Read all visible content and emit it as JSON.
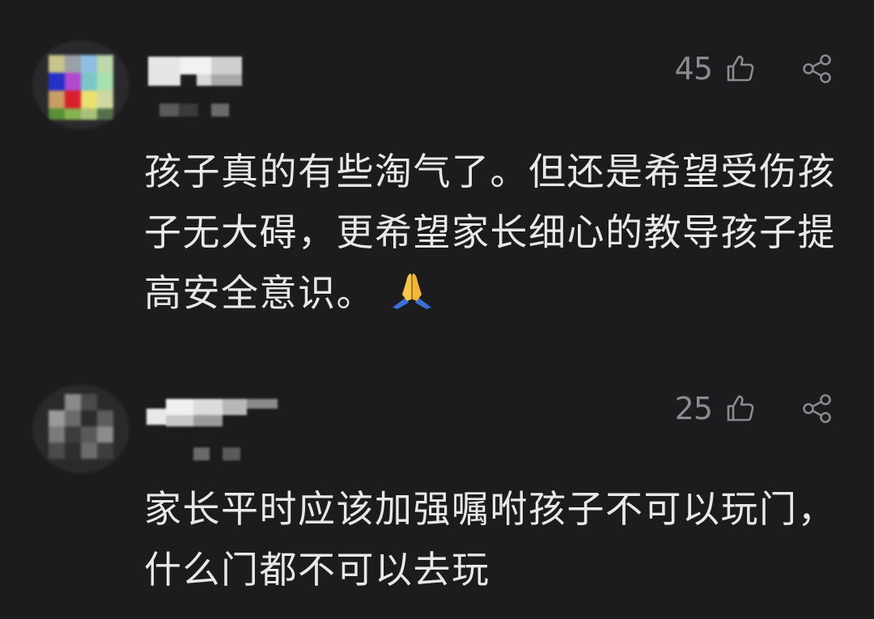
{
  "comments": [
    {
      "likes": "45",
      "text_lines": [
        "孩子真的有些淘气了。但还是希望受伤孩",
        "子无大碍，更希望家长细心的教导孩子提",
        "高安全意识。"
      ],
      "emoji": "folded-hands"
    },
    {
      "likes": "25",
      "text_lines": [
        "家长平时应该加强嘱咐孩子不可以玩门，",
        "什么门都不可以去玩"
      ]
    }
  ],
  "colors": {
    "background": "#1c1c1e",
    "text": "#e8e8e8",
    "muted": "#8a8a8f"
  },
  "icons": {
    "like": "thumbs-up-icon",
    "share": "share-icon"
  }
}
